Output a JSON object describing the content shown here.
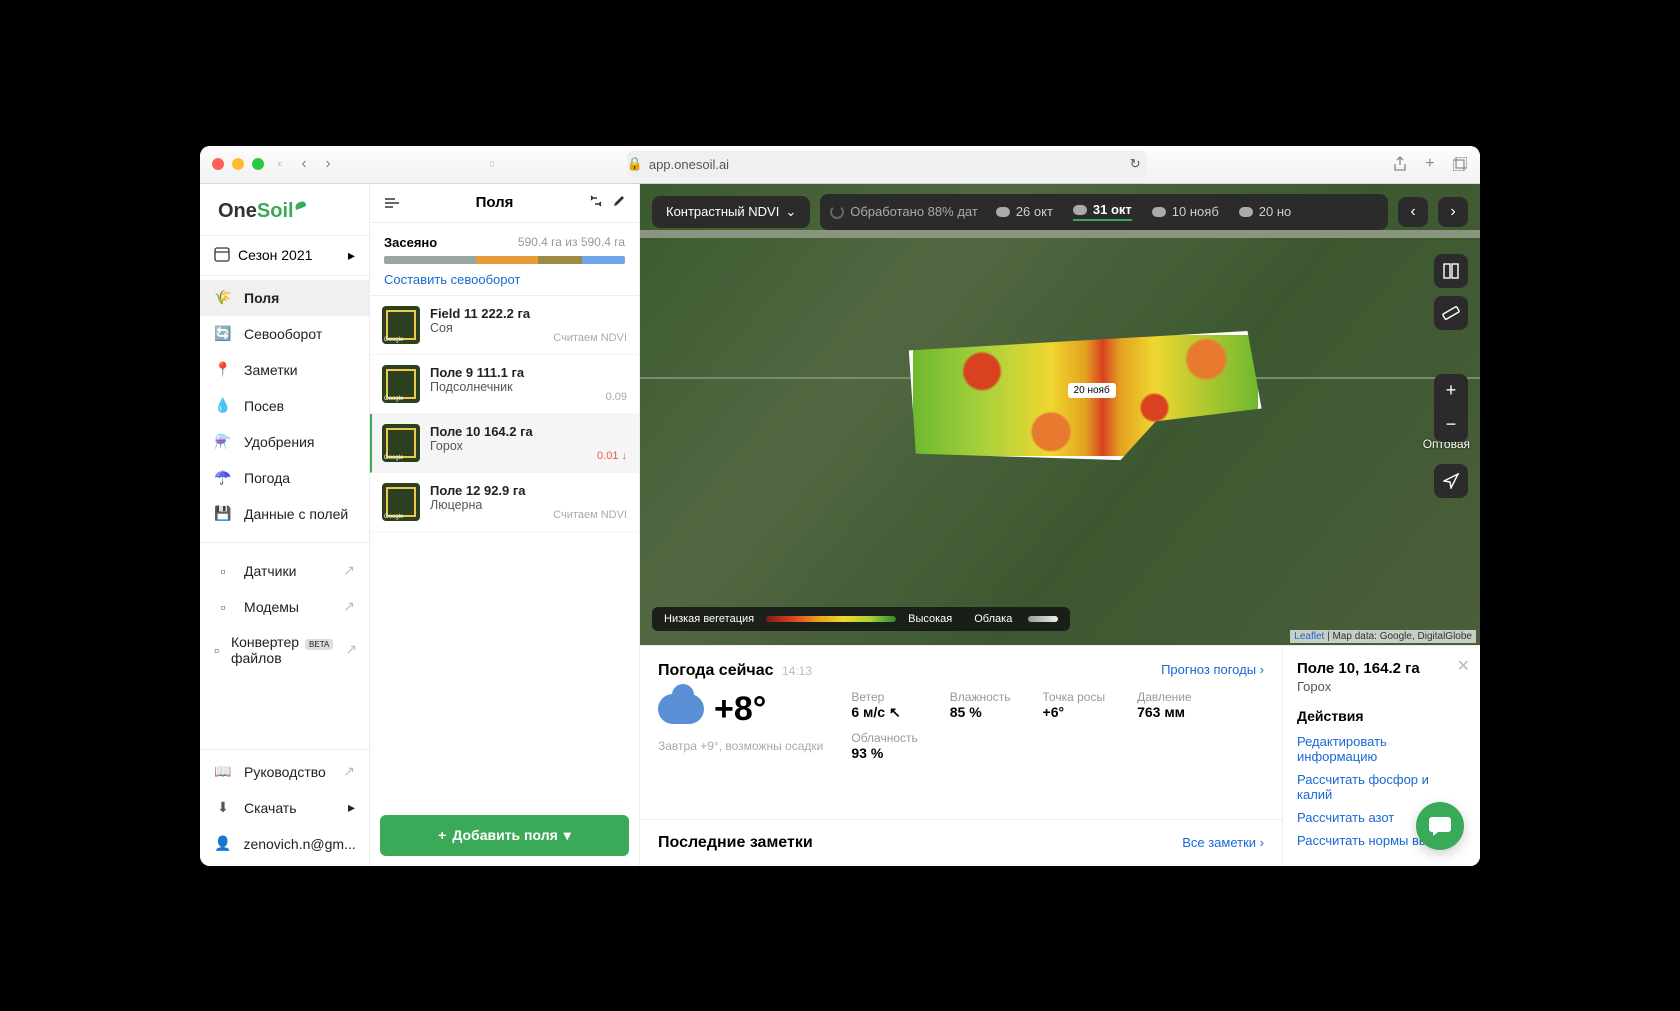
{
  "browser": {
    "url": "app.onesoil.ai"
  },
  "logo": {
    "part1": "One",
    "part2": "Soil"
  },
  "season": {
    "label": "Сезон 2021"
  },
  "nav": {
    "main": [
      {
        "label": "Поля",
        "active": true
      },
      {
        "label": "Севооборот"
      },
      {
        "label": "Заметки"
      },
      {
        "label": "Посев"
      },
      {
        "label": "Удобрения"
      },
      {
        "label": "Погода"
      },
      {
        "label": "Данные с полей"
      }
    ],
    "ext": [
      {
        "label": "Датчики"
      },
      {
        "label": "Модемы"
      },
      {
        "label": "Конвертер файлов",
        "beta": "BETA"
      }
    ],
    "bottom": [
      {
        "label": "Руководство"
      },
      {
        "label": "Скачать"
      },
      {
        "label": "zenovich.n@gm..."
      }
    ]
  },
  "fieldPanel": {
    "title": "Поля",
    "summary": {
      "label": "Засеяно",
      "value": "590.4 га из 590.4 га",
      "segments": [
        {
          "color": "#9aa6a0",
          "pct": 38
        },
        {
          "color": "#e79c37",
          "pct": 26
        },
        {
          "color": "#9b8a48",
          "pct": 18
        },
        {
          "color": "#6fa6e8",
          "pct": 18
        }
      ],
      "link": "Составить севооборот"
    },
    "fields": [
      {
        "name": "Field 11 222.2 га",
        "crop": "Соя",
        "meta": "Считаем NDVI"
      },
      {
        "name": "Поле 9 111.1 га",
        "crop": "Подсолнечник",
        "meta": "0.09"
      },
      {
        "name": "Поле 10 164.2 га",
        "crop": "Горох",
        "meta": "0.01 ↓",
        "active": true,
        "metaDown": true
      },
      {
        "name": "Поле 12 92.9 га",
        "crop": "Люцерна",
        "meta": "Считаем NDVI"
      }
    ],
    "addBtn": "Добавить поля"
  },
  "map": {
    "ndviBtn": "Контрастный NDVI",
    "processing": "Обработано 88% дат",
    "dates": [
      {
        "label": "26 окт"
      },
      {
        "label": "31 окт",
        "active": true
      },
      {
        "label": "10 нояб"
      },
      {
        "label": "20 но"
      }
    ],
    "fieldLabel": "20 нояб",
    "legend": {
      "low": "Низкая вегетация",
      "high": "Высокая",
      "clouds": "Облака"
    },
    "attribution": {
      "leaflet": "Leaflet",
      "rest": " | Map data: Google, DigitalGlobe"
    },
    "townLabel": "Оптовая"
  },
  "weather": {
    "title": "Погода сейчас",
    "time": "14:13",
    "forecastLink": "Прогноз погоды ›",
    "temp": "+8°",
    "stats": {
      "wind": {
        "label": "Ветер",
        "value": "6 м/с ↖"
      },
      "humidity": {
        "label": "Влажность",
        "value": "85 %"
      },
      "dewpoint": {
        "label": "Точка росы",
        "value": "+6°"
      },
      "pressure": {
        "label": "Давление",
        "value": "763 мм"
      },
      "clouds": {
        "label": "Облачность",
        "value": "93 %"
      }
    },
    "tomorrow": "Завтра +9°,\nвозможны осадки"
  },
  "notes": {
    "title": "Последние заметки",
    "link": "Все заметки ›"
  },
  "detail": {
    "title": "Поле 10, 164.2 га",
    "crop": "Горох",
    "actionsTitle": "Действия",
    "actions": [
      "Редактировать информацию",
      "Рассчитать фосфор и калий",
      "Рассчитать азот",
      "Рассчитать нормы высе"
    ]
  }
}
